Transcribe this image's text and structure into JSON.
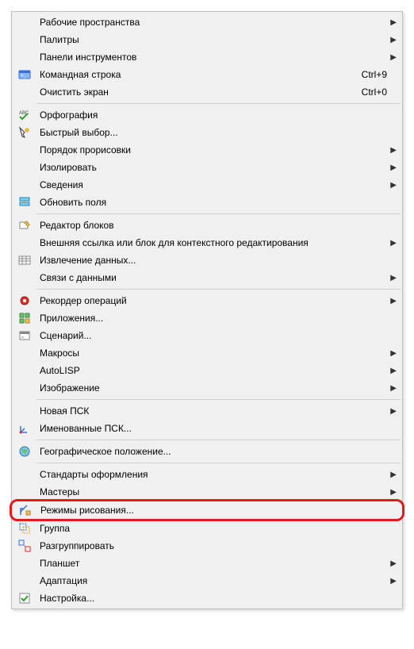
{
  "menu": {
    "items": [
      {
        "label": "Рабочие пространства",
        "icon": null,
        "submenu": true
      },
      {
        "label": "Палитры",
        "icon": null,
        "submenu": true
      },
      {
        "label": "Панели инструментов",
        "icon": null,
        "submenu": true
      },
      {
        "label": "Командная строка",
        "icon": "command-line",
        "shortcut": "Ctrl+9"
      },
      {
        "label": "Очистить экран",
        "icon": null,
        "shortcut": "Ctrl+0"
      },
      {
        "sep": true
      },
      {
        "label": "Орфография",
        "icon": "spellcheck"
      },
      {
        "label": "Быстрый выбор...",
        "icon": "quick-select"
      },
      {
        "label": "Порядок прорисовки",
        "icon": null,
        "submenu": true
      },
      {
        "label": "Изолировать",
        "icon": null,
        "submenu": true
      },
      {
        "label": "Сведения",
        "icon": null,
        "submenu": true
      },
      {
        "label": "Обновить поля",
        "icon": "update-fields"
      },
      {
        "sep": true
      },
      {
        "label": "Редактор блоков",
        "icon": "block-editor"
      },
      {
        "label": "Внешняя ссылка или блок для контекстного редактирования",
        "icon": null,
        "submenu": true
      },
      {
        "label": "Извлечение данных...",
        "icon": "data-extract"
      },
      {
        "label": "Связи с данными",
        "icon": null,
        "submenu": true
      },
      {
        "sep": true
      },
      {
        "label": "Рекордер операций",
        "icon": "recorder",
        "submenu": true
      },
      {
        "label": "Приложения...",
        "icon": "apps"
      },
      {
        "label": "Сценарий...",
        "icon": "script"
      },
      {
        "label": "Макросы",
        "icon": null,
        "submenu": true
      },
      {
        "label": "AutoLISP",
        "icon": null,
        "submenu": true
      },
      {
        "label": "Изображение",
        "icon": null,
        "submenu": true
      },
      {
        "sep": true
      },
      {
        "label": "Новая ПСК",
        "icon": null,
        "submenu": true
      },
      {
        "label": "Именованные ПСК...",
        "icon": "named-ucs"
      },
      {
        "sep": true
      },
      {
        "label": "Географическое положение...",
        "icon": "geo"
      },
      {
        "sep": true
      },
      {
        "label": "Стандарты оформления",
        "icon": null,
        "submenu": true
      },
      {
        "label": "Мастеры",
        "icon": null,
        "submenu": true
      },
      {
        "label": "Режимы рисования...",
        "icon": "draft-settings",
        "highlighted": true
      },
      {
        "label": "Группа",
        "icon": "group"
      },
      {
        "label": "Разгруппировать",
        "icon": "ungroup"
      },
      {
        "label": "Планшет",
        "icon": null,
        "submenu": true
      },
      {
        "label": "Адаптация",
        "icon": null,
        "submenu": true
      },
      {
        "label": "Настройка...",
        "icon": "settings-check"
      }
    ]
  }
}
